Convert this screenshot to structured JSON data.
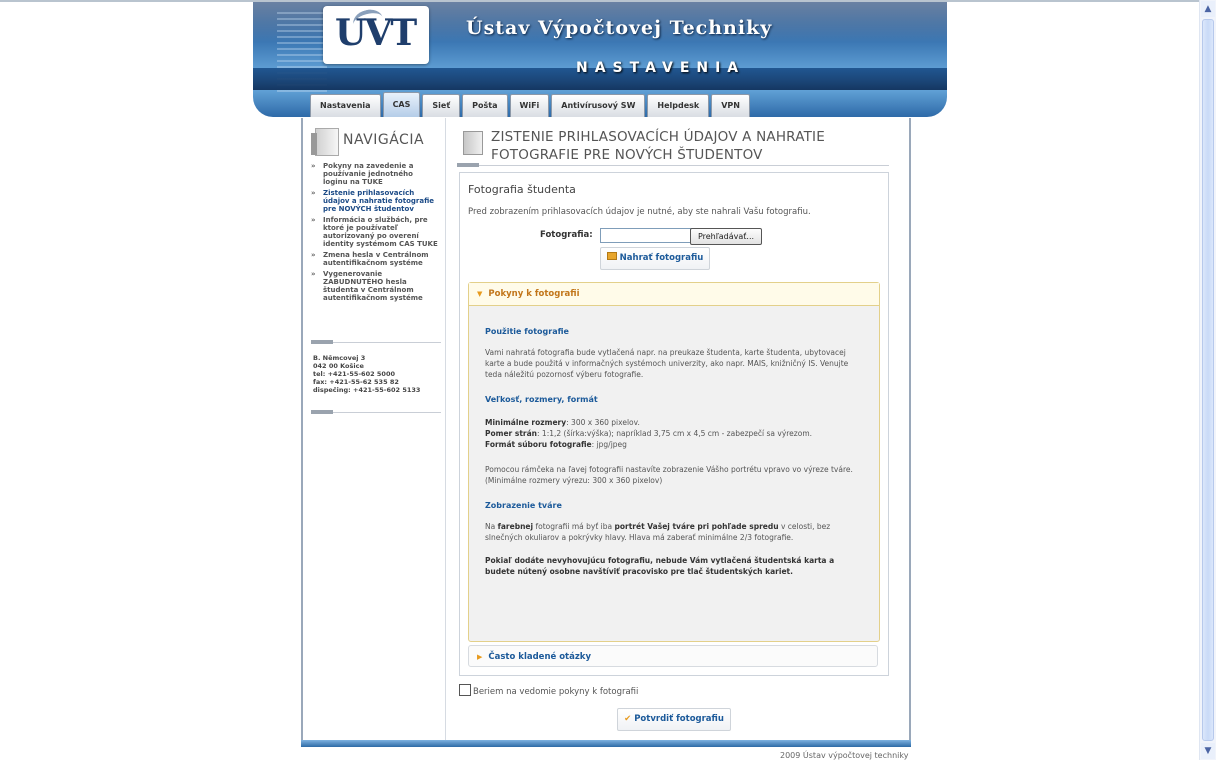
{
  "header": {
    "logo_text": "UVT",
    "title": "Ústav Výpočtovej Techniky",
    "subtitle": "NASTAVENIA"
  },
  "tabs": [
    {
      "label": "Nastavenia"
    },
    {
      "label": "CAS",
      "active": true
    },
    {
      "label": "Sieť"
    },
    {
      "label": "Pošta"
    },
    {
      "label": "WiFi"
    },
    {
      "label": "Antivírusový SW"
    },
    {
      "label": "Helpdesk"
    },
    {
      "label": "VPN"
    }
  ],
  "nav": {
    "title": "NAVIGÁCIA",
    "items": [
      {
        "label": "Pokyny na zavedenie a používanie jednotného loginu na TUKE"
      },
      {
        "label": "Zistenie prihlasovacích údajov a nahratie fotografie pre NOVÝCH študentov",
        "current": true
      },
      {
        "label": "Informácia o službách, pre ktoré je používateľ autorizovaný po overení identity systémom CAS TUKE"
      },
      {
        "label": "Zmena hesla v Centrálnom autentifikačnom systéme"
      },
      {
        "label": "Vygenerovanie ZABUDNUTÉHO hesla študenta v Centrálnom autentifikačnom systéme"
      }
    ],
    "address": {
      "line1": "B. Němcovej 3",
      "line2": "042 00 Košice",
      "line3": "tel: +421-55-602 5000",
      "line4": "fax: +421-55-62 535 82",
      "line5": "dispečing: +421-55-602 5133"
    }
  },
  "main": {
    "title": "ZISTENIE PRIHLASOVACÍCH ÚDAJOV A NAHRATIE FOTOGRAFIE PRE NOVÝCH ŠTUDENTOV",
    "section_title": "Fotografia študenta",
    "intro": "Pred zobrazením prihlasovacích údajov je nutné, aby ste nahrali Vašu fotografiu.",
    "photo_label": "Fotografia:",
    "file_value": "",
    "browse_label": "Prehľadávať...",
    "upload_label": "Nahrať fotografiu",
    "accordion1": {
      "title": "Pokyny k fotografii",
      "h1": "Použitie fotografie",
      "p1": "Vami nahratá fotografia bude vytlačená napr. na preukaze študenta, karte študenta, ubytovacej karte a bude použitá v informačných systémoch univerzity, ako napr. MAIS, knižničný IS. Venujte teda náležitú pozornosť výberu fotografie.",
      "h2": "Veľkosť, rozmery, formát",
      "min_label": "Minimálne rozmery",
      "min_value": ": 300 x 360 pixelov.",
      "ratio_label": "Pomer strán",
      "ratio_value": ": 1:1,2 (šírka:výška); napríklad 3,75 cm x 4,5 cm - zabezpečí sa výrezom.",
      "format_label": "Formát súboru fotografie",
      "format_value": ": jpg/jpeg",
      "p3a": "Pomocou rámčeka na ľavej fotografii nastavíte zobrazenie Vášho portrétu vpravo vo výreze tváre.",
      "p3b": "(Minimálne rozmery výrezu: 300 x 360 pixelov)",
      "h3": "Zobrazenie tváre",
      "p4_1": "Na ",
      "p4_b1": "farebnej",
      "p4_2": " fotografii má byť iba ",
      "p4_b2": "portrét Vašej tváre pri pohľade spredu",
      "p4_3": " v celosti, bez slnečných okuliarov a pokrývky hlavy. Hlava má zaberať minimálne 2/3 fotografie.",
      "p5": "Pokiaľ dodáte nevyhovujúcu fotografiu, nebude Vám vytlačená študentská karta a budete nútený osobne navštíviť pracovisko pre tlač študentských kariet."
    },
    "accordion2": {
      "title": "Často kladené otázky"
    },
    "agree_label": "Beriem na vedomie pokyny k fotografii",
    "confirm_label": "Potvrdiť fotografiu"
  },
  "footer": "2009 Ústav výpočtovej techniky"
}
